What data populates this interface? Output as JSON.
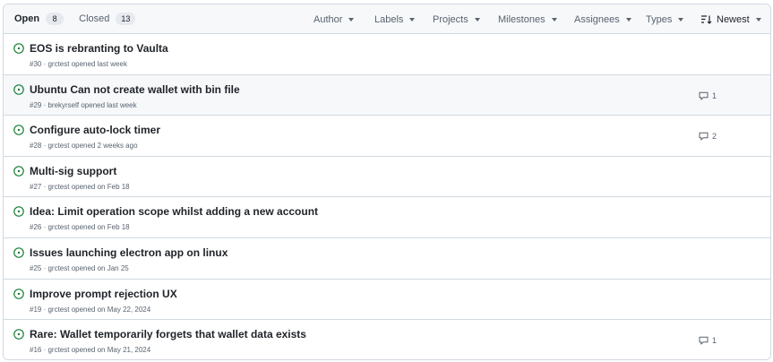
{
  "tabs": {
    "open": {
      "label": "Open",
      "count": "8"
    },
    "closed": {
      "label": "Closed",
      "count": "13"
    }
  },
  "filters": {
    "author": "Author",
    "labels": "Labels",
    "projects": "Projects",
    "milestones": "Milestones",
    "assignees": "Assignees",
    "types": "Types",
    "sort": "Newest"
  },
  "colors": {
    "open_issue": "#1a7f37",
    "border": "#d1d9e0",
    "header_bg": "#f6f8fa"
  },
  "issues": [
    {
      "title": "EOS is rebranting to Vaulta",
      "meta": "#30 · grctest opened last week",
      "comments": ""
    },
    {
      "title": "Ubuntu Can not create wallet with bin file",
      "meta": "#29 · brekyrself opened last week",
      "comments": "1"
    },
    {
      "title": "Configure auto-lock timer",
      "meta": "#28 · grctest opened 2 weeks ago",
      "comments": "2"
    },
    {
      "title": "Multi-sig support",
      "meta": "#27 · grctest opened on Feb 18",
      "comments": ""
    },
    {
      "title": "Idea: Limit operation scope whilst adding a new account",
      "meta": "#26 · grctest opened on Feb 18",
      "comments": ""
    },
    {
      "title": "Issues launching electron app on linux",
      "meta": "#25 · grctest opened on Jan 25",
      "comments": ""
    },
    {
      "title": "Improve prompt rejection UX",
      "meta": "#19 · grctest opened on May 22, 2024",
      "comments": ""
    },
    {
      "title": "Rare: Wallet temporarily forgets that wallet data exists",
      "meta": "#16 · grctest opened on May 21, 2024",
      "comments": "1"
    }
  ]
}
